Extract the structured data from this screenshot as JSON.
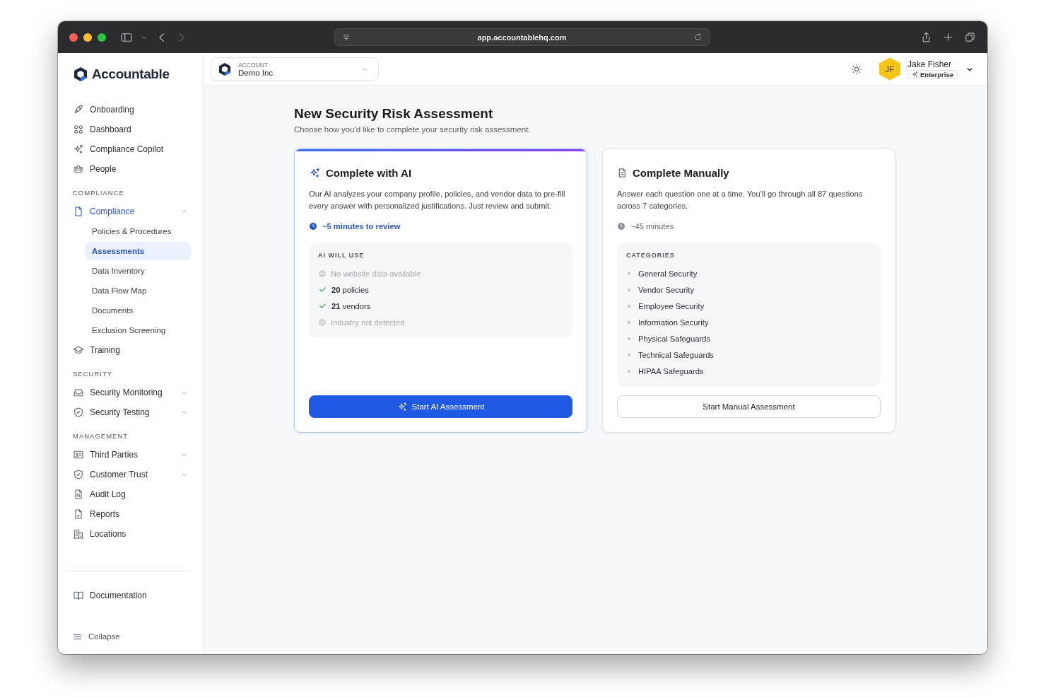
{
  "browser": {
    "url": "app.accountablehq.com"
  },
  "sidebar": {
    "logo": "Accountable",
    "sections": [
      {
        "items": [
          {
            "label": "Onboarding",
            "selected": false
          },
          {
            "label": "Dashboard",
            "selected": false
          },
          {
            "label": "Compliance Copilot",
            "selected": false
          },
          {
            "label": "People",
            "selected": false
          }
        ]
      },
      {
        "heading": "COMPLIANCE",
        "items": [
          {
            "label": "Compliance",
            "selected": true,
            "expanded": true,
            "children": [
              {
                "label": "Policies & Procedures",
                "selected": false
              },
              {
                "label": "Assessments",
                "selected": true
              },
              {
                "label": "Data Inventory",
                "selected": false
              },
              {
                "label": "Data Flow Map",
                "selected": false
              },
              {
                "label": "Documents",
                "selected": false
              },
              {
                "label": "Exclusion Screening",
                "selected": false
              }
            ]
          },
          {
            "label": "Training",
            "selected": false
          }
        ]
      },
      {
        "heading": "SECURITY",
        "items": [
          {
            "label": "Security Monitoring",
            "selected": false,
            "expanded": false
          },
          {
            "label": "Security Testing",
            "selected": false,
            "expanded": false
          }
        ]
      },
      {
        "heading": "MANAGEMENT",
        "items": [
          {
            "label": "Third Parties",
            "selected": false,
            "expanded": false
          },
          {
            "label": "Customer Trust",
            "selected": false,
            "expanded": false
          },
          {
            "label": "Audit Log",
            "selected": false
          },
          {
            "label": "Reports",
            "selected": false
          },
          {
            "label": "Locations",
            "selected": false
          }
        ]
      }
    ],
    "footer_items": [
      {
        "label": "Documentation",
        "selected": false
      }
    ],
    "collapse": "Collapse"
  },
  "account": {
    "label": "ACCOUNT",
    "value": "Demo Inc"
  },
  "user": {
    "initials": "JF",
    "name": "Jake Fisher",
    "plan": "Enterprise"
  },
  "page": {
    "title": "New Security Risk Assessment",
    "subtitle": "Choose how you'd like to complete your security risk assessment."
  },
  "options": [
    {
      "kind": "ai",
      "title": "Complete with AI",
      "description": "Our AI analyzes your company profile, policies, and vendor data to pre-fill every answer with personalized justifications. Just review and submit.",
      "time": "~5 minutes to review",
      "list_heading": "AI WILL USE",
      "list": [
        {
          "text": "No website data available",
          "available": false
        },
        {
          "text": "**20** policies",
          "available": true
        },
        {
          "text": "**21** vendors",
          "available": true
        },
        {
          "text": "Industry not detected",
          "available": false
        }
      ],
      "button": "Start AI Assessment"
    },
    {
      "kind": "manual",
      "title": "Complete Manually",
      "description": "Answer each question one at a time. You'll go through all 87 questions across 7 categories.",
      "time": "~45 minutes",
      "list_heading": "CATEGORIES",
      "list": [
        {
          "text": "General Security"
        },
        {
          "text": "Vendor Security"
        },
        {
          "text": "Employee Security"
        },
        {
          "text": "Information Security"
        },
        {
          "text": "Physical Safeguards"
        },
        {
          "text": "Technical Safeguards"
        },
        {
          "text": "HIPAA Safeguards"
        }
      ],
      "button": "Start Manual Assessment"
    }
  ]
}
